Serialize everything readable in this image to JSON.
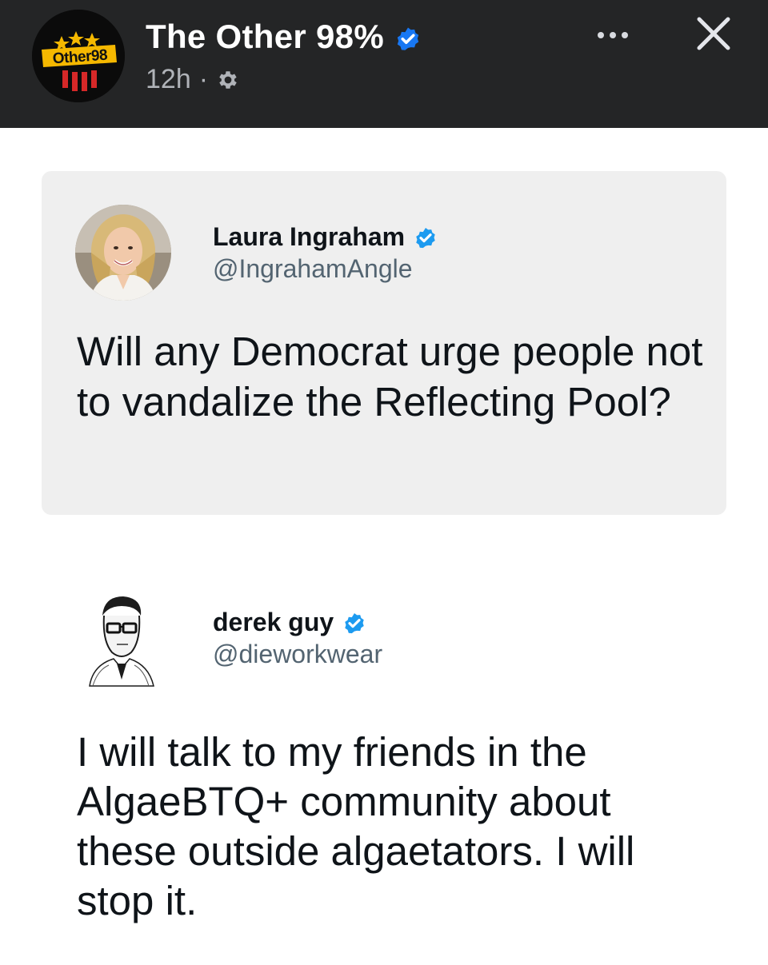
{
  "header": {
    "page_name": "The Other 98%",
    "logo_text": "Other98",
    "time_ago": "12h",
    "separator": "·",
    "icons": {
      "verified": "verified-badge-icon",
      "privacy": "gear-icon",
      "more": "more-options-icon",
      "close": "close-icon"
    }
  },
  "tweets": [
    {
      "author_name": "Laura Ingraham",
      "handle": "@IngrahamAngle",
      "text": "Will any Democrat urge people not to vandalize the Reflecting Pool?",
      "verified": true,
      "background": "#efefef"
    },
    {
      "author_name": "derek guy",
      "handle": "@dieworkwear",
      "text": "I will talk to my friends in the AlgaeBTQ+ community about these outside algaetators. I will stop it.",
      "verified": true,
      "background": "#ffffff"
    }
  ],
  "colors": {
    "header_bg": "#242526",
    "verified_blue": "#1d9bf0",
    "fb_verified_blue": "#1877f2",
    "text_dark": "#0f1419",
    "text_muted": "#536471"
  }
}
